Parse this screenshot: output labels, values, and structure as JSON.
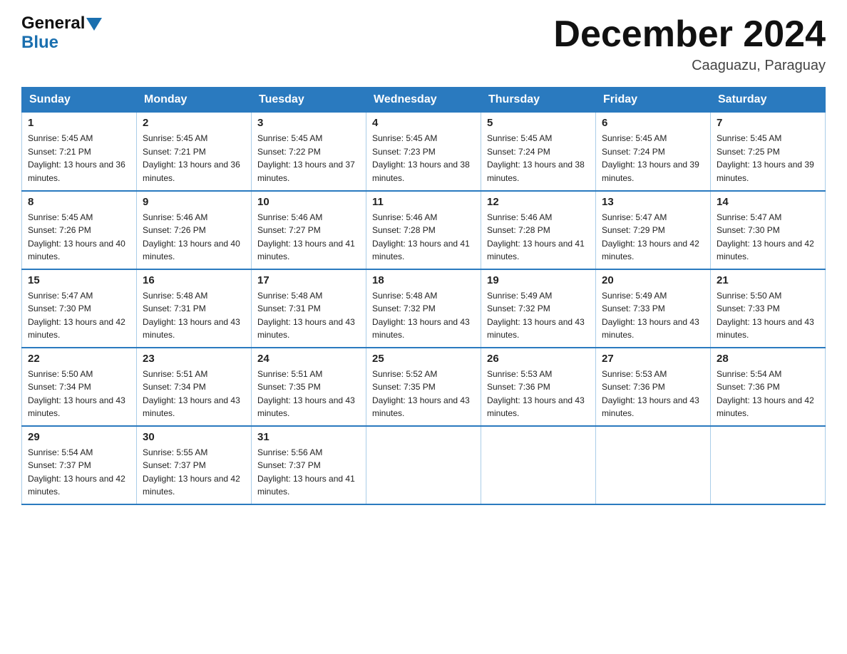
{
  "header": {
    "logo_general": "General",
    "logo_blue": "Blue",
    "title": "December 2024",
    "location": "Caaguazu, Paraguay"
  },
  "days_of_week": [
    "Sunday",
    "Monday",
    "Tuesday",
    "Wednesday",
    "Thursday",
    "Friday",
    "Saturday"
  ],
  "weeks": [
    [
      {
        "day": "1",
        "sunrise": "5:45 AM",
        "sunset": "7:21 PM",
        "daylight": "13 hours and 36 minutes."
      },
      {
        "day": "2",
        "sunrise": "5:45 AM",
        "sunset": "7:21 PM",
        "daylight": "13 hours and 36 minutes."
      },
      {
        "day": "3",
        "sunrise": "5:45 AM",
        "sunset": "7:22 PM",
        "daylight": "13 hours and 37 minutes."
      },
      {
        "day": "4",
        "sunrise": "5:45 AM",
        "sunset": "7:23 PM",
        "daylight": "13 hours and 38 minutes."
      },
      {
        "day": "5",
        "sunrise": "5:45 AM",
        "sunset": "7:24 PM",
        "daylight": "13 hours and 38 minutes."
      },
      {
        "day": "6",
        "sunrise": "5:45 AM",
        "sunset": "7:24 PM",
        "daylight": "13 hours and 39 minutes."
      },
      {
        "day": "7",
        "sunrise": "5:45 AM",
        "sunset": "7:25 PM",
        "daylight": "13 hours and 39 minutes."
      }
    ],
    [
      {
        "day": "8",
        "sunrise": "5:45 AM",
        "sunset": "7:26 PM",
        "daylight": "13 hours and 40 minutes."
      },
      {
        "day": "9",
        "sunrise": "5:46 AM",
        "sunset": "7:26 PM",
        "daylight": "13 hours and 40 minutes."
      },
      {
        "day": "10",
        "sunrise": "5:46 AM",
        "sunset": "7:27 PM",
        "daylight": "13 hours and 41 minutes."
      },
      {
        "day": "11",
        "sunrise": "5:46 AM",
        "sunset": "7:28 PM",
        "daylight": "13 hours and 41 minutes."
      },
      {
        "day": "12",
        "sunrise": "5:46 AM",
        "sunset": "7:28 PM",
        "daylight": "13 hours and 41 minutes."
      },
      {
        "day": "13",
        "sunrise": "5:47 AM",
        "sunset": "7:29 PM",
        "daylight": "13 hours and 42 minutes."
      },
      {
        "day": "14",
        "sunrise": "5:47 AM",
        "sunset": "7:30 PM",
        "daylight": "13 hours and 42 minutes."
      }
    ],
    [
      {
        "day": "15",
        "sunrise": "5:47 AM",
        "sunset": "7:30 PM",
        "daylight": "13 hours and 42 minutes."
      },
      {
        "day": "16",
        "sunrise": "5:48 AM",
        "sunset": "7:31 PM",
        "daylight": "13 hours and 43 minutes."
      },
      {
        "day": "17",
        "sunrise": "5:48 AM",
        "sunset": "7:31 PM",
        "daylight": "13 hours and 43 minutes."
      },
      {
        "day": "18",
        "sunrise": "5:48 AM",
        "sunset": "7:32 PM",
        "daylight": "13 hours and 43 minutes."
      },
      {
        "day": "19",
        "sunrise": "5:49 AM",
        "sunset": "7:32 PM",
        "daylight": "13 hours and 43 minutes."
      },
      {
        "day": "20",
        "sunrise": "5:49 AM",
        "sunset": "7:33 PM",
        "daylight": "13 hours and 43 minutes."
      },
      {
        "day": "21",
        "sunrise": "5:50 AM",
        "sunset": "7:33 PM",
        "daylight": "13 hours and 43 minutes."
      }
    ],
    [
      {
        "day": "22",
        "sunrise": "5:50 AM",
        "sunset": "7:34 PM",
        "daylight": "13 hours and 43 minutes."
      },
      {
        "day": "23",
        "sunrise": "5:51 AM",
        "sunset": "7:34 PM",
        "daylight": "13 hours and 43 minutes."
      },
      {
        "day": "24",
        "sunrise": "5:51 AM",
        "sunset": "7:35 PM",
        "daylight": "13 hours and 43 minutes."
      },
      {
        "day": "25",
        "sunrise": "5:52 AM",
        "sunset": "7:35 PM",
        "daylight": "13 hours and 43 minutes."
      },
      {
        "day": "26",
        "sunrise": "5:53 AM",
        "sunset": "7:36 PM",
        "daylight": "13 hours and 43 minutes."
      },
      {
        "day": "27",
        "sunrise": "5:53 AM",
        "sunset": "7:36 PM",
        "daylight": "13 hours and 43 minutes."
      },
      {
        "day": "28",
        "sunrise": "5:54 AM",
        "sunset": "7:36 PM",
        "daylight": "13 hours and 42 minutes."
      }
    ],
    [
      {
        "day": "29",
        "sunrise": "5:54 AM",
        "sunset": "7:37 PM",
        "daylight": "13 hours and 42 minutes."
      },
      {
        "day": "30",
        "sunrise": "5:55 AM",
        "sunset": "7:37 PM",
        "daylight": "13 hours and 42 minutes."
      },
      {
        "day": "31",
        "sunrise": "5:56 AM",
        "sunset": "7:37 PM",
        "daylight": "13 hours and 41 minutes."
      },
      null,
      null,
      null,
      null
    ]
  ]
}
